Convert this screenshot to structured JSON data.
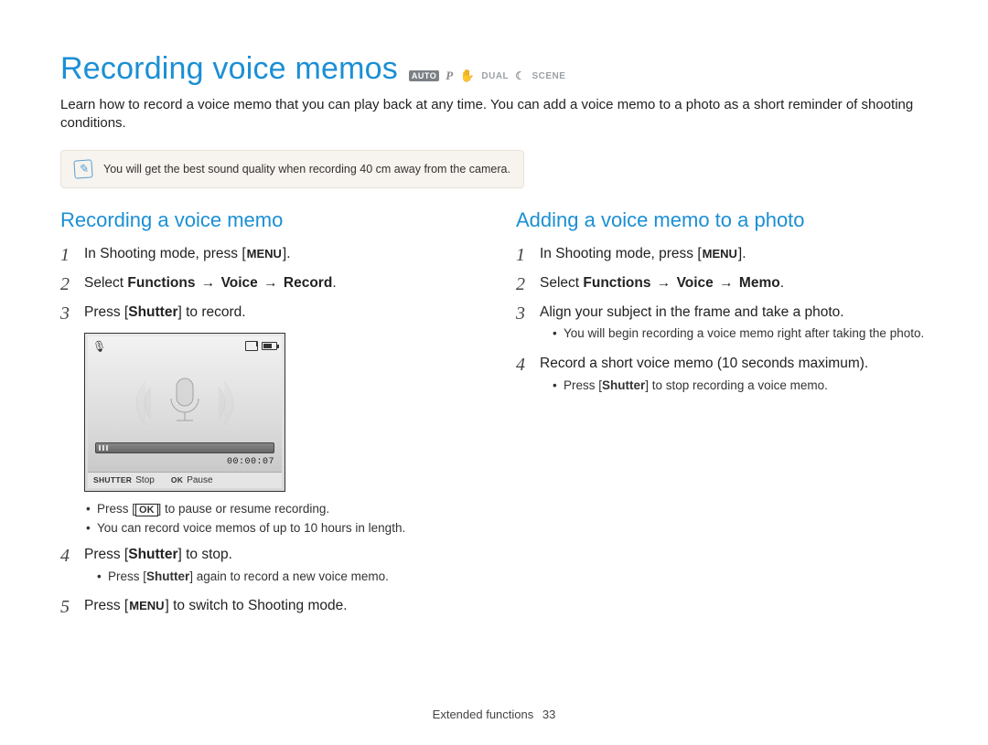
{
  "title": "Recording voice memos",
  "modes": {
    "auto": "AUTO",
    "p": "P",
    "dual": "DUAL",
    "scene": "SCENE"
  },
  "intro": "Learn how to record a voice memo that you can play back at any time. You can add a voice memo to a photo as a short reminder of shooting conditions.",
  "tip": "You will get the best sound quality when recording 40 cm away from the camera.",
  "left": {
    "heading": "Recording a voice memo",
    "step1_pre": "In Shooting mode, press [",
    "step1_btn": "MENU",
    "step1_post": "].",
    "step2_pre": "Select ",
    "step2_path_a": "Functions",
    "step2_path_b": "Voice",
    "step2_path_c": "Record",
    "step3_pre": "Press [",
    "step3_b": "Shutter",
    "step3_post": "] to record.",
    "screen": {
      "timecode": "00:00:07",
      "shutter_key": "SHUTTER",
      "shutter_label": "Stop",
      "ok_key": "OK",
      "ok_label": "Pause"
    },
    "step3_bullets": {
      "b0_pre": "Press [",
      "b0_btn": "OK",
      "b0_post": "] to pause or resume recording.",
      "b1": "You can record voice memos of up to 10 hours in length."
    },
    "step4_pre": "Press [",
    "step4_b": "Shutter",
    "step4_post": "] to stop.",
    "step4_bullets": {
      "b0_pre": "Press [",
      "b0_b": "Shutter",
      "b0_post": "] again to record a new voice memo."
    },
    "step5_pre": "Press [",
    "step5_btn": "MENU",
    "step5_post": "] to switch to Shooting mode."
  },
  "right": {
    "heading": "Adding a voice memo to a photo",
    "step1_pre": "In Shooting mode, press [",
    "step1_btn": "MENU",
    "step1_post": "].",
    "step2_pre": "Select ",
    "step2_path_a": "Functions",
    "step2_path_b": "Voice",
    "step2_path_c": "Memo",
    "step3": "Align your subject in the frame and take a photo.",
    "step3_bullets": {
      "b0": "You will begin recording a voice memo right after taking the photo."
    },
    "step4": "Record a short voice memo (10 seconds maximum).",
    "step4_bullets": {
      "b0_pre": "Press [",
      "b0_b": "Shutter",
      "b0_post": "] to stop recording a voice memo."
    }
  },
  "footer": {
    "section": "Extended functions",
    "page": "33"
  }
}
